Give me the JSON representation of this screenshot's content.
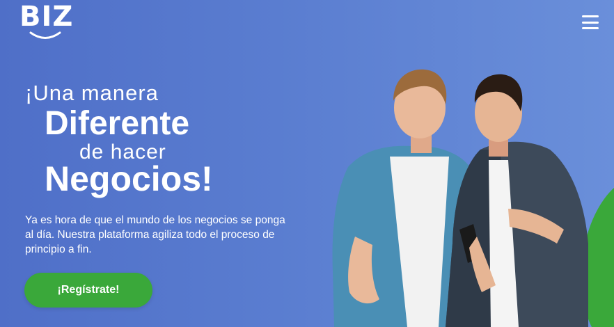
{
  "brand": {
    "name": "BIZ",
    "accent_color": "#3aa83a"
  },
  "header": {
    "menu_icon": "hamburger-icon"
  },
  "hero": {
    "headline": {
      "line1": "¡Una manera",
      "line2": "Diferente",
      "line3": "de hacer",
      "line4": "Negocios!"
    },
    "description_line1": "Ya es hora de que el mundo de los negocios se ponga",
    "description_line2": "al día. Nuestra plataforma agiliza todo el proceso de",
    "description_line3": "principio a fin.",
    "cta_label": "¡Regístrate!"
  }
}
